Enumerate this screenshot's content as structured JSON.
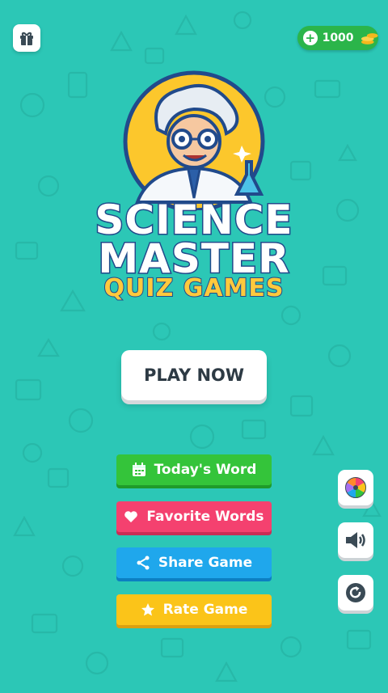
{
  "coins": {
    "count": "1000"
  },
  "logo": {
    "line1": "SCIENCE",
    "line2": "MASTER",
    "line3": "QUIZ GAMES"
  },
  "play": {
    "label": "PLAY NOW"
  },
  "menu": [
    {
      "label": "Today's Word",
      "icon": "calendar-icon",
      "color": "#34c43a"
    },
    {
      "label": "Favorite Words",
      "icon": "heart-icon",
      "color": "#f4416f"
    },
    {
      "label": "Share Game",
      "icon": "share-icon",
      "color": "#1fa7ec"
    },
    {
      "label": "Rate Game",
      "icon": "star-icon",
      "color": "#fbc419"
    }
  ],
  "side": [
    {
      "icon": "spin-wheel-icon"
    },
    {
      "icon": "speaker-icon"
    },
    {
      "icon": "refresh-icon"
    }
  ],
  "colors": {
    "background": "#2cc7b6",
    "brand_outline": "#214a8b",
    "coin_pill": "#2bb54a"
  }
}
